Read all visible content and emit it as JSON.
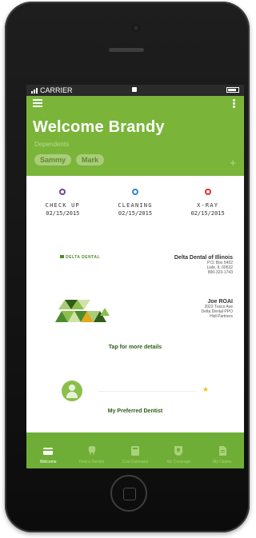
{
  "status_bar": {
    "carrier": "CARRIER"
  },
  "header": {
    "title": "Welcome Brandy",
    "dependents_label": "Dependents",
    "dependents": [
      "Sammy",
      "Mark"
    ],
    "add_label": "+"
  },
  "appointments": [
    {
      "title": "CHECK UP",
      "date": "02/15/2015",
      "color": "#7a3f9d"
    },
    {
      "title": "CLEANING",
      "date": "02/15/2015",
      "color": "#2e8bc9"
    },
    {
      "title": "X-RAY",
      "date": "02/15/2015",
      "color": "#d9342b"
    }
  ],
  "insurance_card": {
    "logo_text": "DELTA DENTAL",
    "insurer_name": "Delta Dental of Illinois",
    "insurer_lines": [
      "P.O. Box 5402",
      "Lisle, IL 60532",
      "800-323-1743"
    ],
    "member_name": "Joe ROAI",
    "member_lines": [
      "2022 Tusco Ave",
      "Delta Dental PPO",
      "Hidi Partners"
    ],
    "cta": "Tap for more details"
  },
  "preferred_dentist": {
    "label": "My Preferred Dentist",
    "star": "★"
  },
  "tabs": [
    {
      "label": "Welcome",
      "icon": "card-icon",
      "active": true
    },
    {
      "label": "Find a Dentist",
      "icon": "tooth-icon",
      "active": false
    },
    {
      "label": "Cost Estimator",
      "icon": "calculator-icon",
      "active": false
    },
    {
      "label": "My Coverage",
      "icon": "tooth-shield-icon",
      "active": false
    },
    {
      "label": "My Claims",
      "icon": "document-icon",
      "active": false
    }
  ],
  "colors": {
    "brand_green": "#7ab53a",
    "tab_green": "#6fae36"
  }
}
